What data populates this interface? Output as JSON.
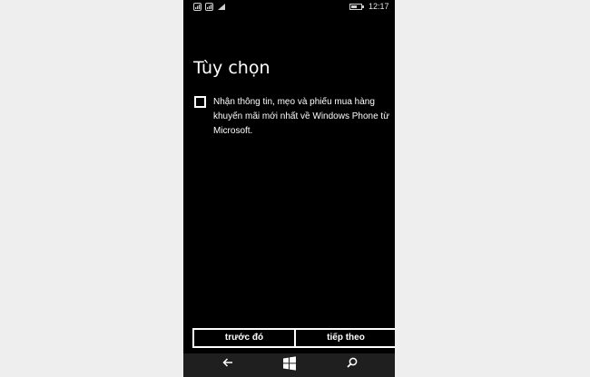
{
  "status_bar": {
    "time": "12:17",
    "battery_level": 0.6,
    "icons": [
      "signal-1-icon",
      "signal-2-icon",
      "wifi-icon",
      "battery-icon"
    ]
  },
  "page": {
    "title": "Tùy chọn"
  },
  "option": {
    "checked": false,
    "label": "Nhận thông tin, mẹo và phiếu mua hàng khuyến mãi mới nhất về Windows Phone từ Microsoft."
  },
  "buttons": {
    "previous_label": "trước đó",
    "next_label": "tiếp theo"
  },
  "nav_bar": {
    "icons": [
      "back-arrow-icon",
      "windows-start-icon",
      "search-icon"
    ]
  },
  "colors": {
    "screen_background": "#000000",
    "text": "#ffffff",
    "nav_bar_background": "#1f1f1f"
  }
}
